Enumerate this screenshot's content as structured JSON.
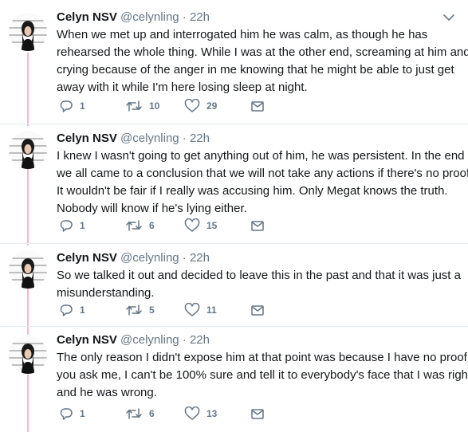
{
  "tweets": [
    {
      "name": "Celyn NSV",
      "handle": "@celynling",
      "separator": "·",
      "time": "22h",
      "lines": [
        "When we met up and interrogated him he was calm, as though he has",
        "rehearsed the whole thing. While I was at the other end, screaming at him and",
        "crying because of the anger in me knowing that he might be able to just get",
        "away with it while I'm here losing sleep at night."
      ],
      "replies": "1",
      "retweets": "10",
      "likes": "29"
    },
    {
      "name": "Celyn NSV",
      "handle": "@celynling",
      "separator": "·",
      "time": "22h",
      "lines": [
        "I knew I wasn't going to get anything out of him, he was persistent. In the end",
        "we all came to a conclusion that we will not take any actions if there's no proof.",
        "It wouldn't be fair if I really was accusing him. Only Megat knows the truth.",
        "Nobody will know if he's lying either."
      ],
      "replies": "1",
      "retweets": "6",
      "likes": "15"
    },
    {
      "name": "Celyn NSV",
      "handle": "@celynling",
      "separator": "·",
      "time": "22h",
      "lines": [
        "So we talked it out and decided to leave this in the past and that it was just a",
        "misunderstanding."
      ],
      "replies": "1",
      "retweets": "5",
      "likes": "11"
    },
    {
      "name": "Celyn NSV",
      "handle": "@celynling",
      "separator": "·",
      "time": "22h",
      "lines": [
        "The only reason I didn't expose him at that point was because I have no proof. If",
        "you ask me, I can't be 100% sure and tell it to everybody's face that I was right",
        "and he was wrong."
      ],
      "replies": "1",
      "retweets": "6",
      "likes": "13"
    }
  ],
  "icons": {
    "reply": "reply-icon",
    "retweet": "retweet-icon",
    "like": "heart-icon",
    "dm": "envelope-icon",
    "menu": "chevron-down-icon"
  },
  "colors": {
    "thread_line": "#f6b7cf",
    "icon_gray": "#657786",
    "text": "#14171a",
    "divider": "#e6ecf0"
  }
}
